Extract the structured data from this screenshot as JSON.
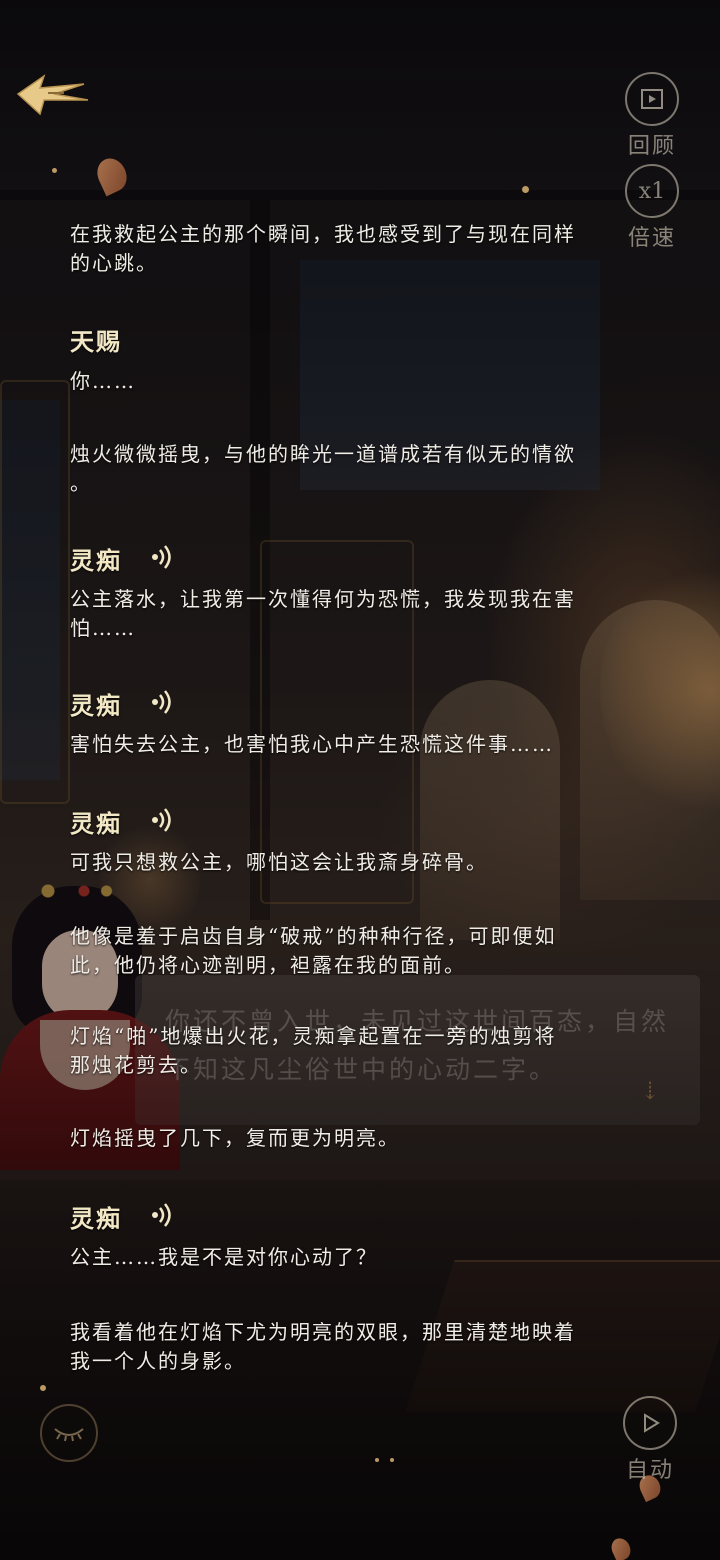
{
  "header": {
    "back_icon": "wing-back-icon",
    "review_label": "回顾",
    "speed_value": "x1",
    "speed_label": "倍速"
  },
  "log": [
    {
      "type": "narration",
      "text_lines": [
        "在我救起公主的那个瞬间，我也感受到了与现在同样",
        "的心跳。"
      ]
    },
    {
      "type": "speech",
      "speaker": "天赐",
      "voice": false,
      "text_lines": [
        "你……"
      ]
    },
    {
      "type": "narration",
      "text_lines": [
        "烛火微微摇曳，与他的眸光一道谱成若有似无的情欲",
        "。"
      ]
    },
    {
      "type": "speech",
      "speaker": "灵痴",
      "voice": true,
      "text_lines": [
        "公主落水，让我第一次懂得何为恐慌，我发现我在害",
        "怕……"
      ]
    },
    {
      "type": "speech",
      "speaker": "灵痴",
      "voice": true,
      "text_lines": [
        "害怕失去公主，也害怕我心中产生恐慌这件事……"
      ]
    },
    {
      "type": "speech",
      "speaker": "灵痴",
      "voice": true,
      "text_lines": [
        "可我只想救公主，哪怕这会让我斎身碎骨。"
      ]
    },
    {
      "type": "narration",
      "text_lines": [
        "他像是羞于启齿自身“破戒”的种种行径，可即便如",
        "此，他仍将心迹剖明，袒露在我的面前。"
      ]
    },
    {
      "type": "narration",
      "text_lines": [
        "灯焰“啪”地爆出火花，灵痴拿起置在一旁的烛剪将",
        "那烛花剪去。"
      ]
    },
    {
      "type": "narration",
      "text_lines": [
        "灯焰摇曳了几下，复而更为明亮。"
      ]
    },
    {
      "type": "speech",
      "speaker": "灵痴",
      "voice": true,
      "text_lines": [
        "公主……我是不是对你心动了？"
      ]
    },
    {
      "type": "narration",
      "text_lines": [
        "我看着他在灯焰下尤为明亮的双眼，那里清楚地映着",
        "我一个人的身影。"
      ]
    }
  ],
  "background_dialog": {
    "lines": [
      "你还不曾入世，未见过这世间百态，自然",
      "不知这凡尘俗世中的心动二字。"
    ]
  },
  "footer": {
    "hide_icon": "closed-eye-icon",
    "auto_label": "自动",
    "auto_icon": "play-icon"
  },
  "colors": {
    "text": "#f0ece6",
    "speaker": "#f3e8c5",
    "accent_gold": "#c9a24a"
  }
}
